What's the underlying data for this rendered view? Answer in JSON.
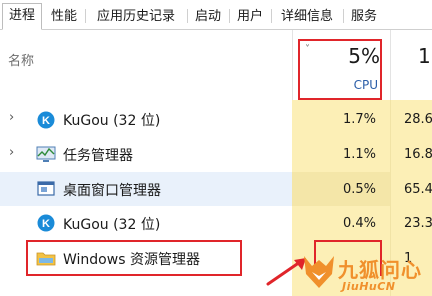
{
  "tabs": [
    {
      "label": "进程",
      "active": true
    },
    {
      "label": "性能",
      "active": false
    },
    {
      "label": "应用历史记录",
      "active": false
    },
    {
      "label": "启动",
      "active": false
    },
    {
      "label": "用户",
      "active": false
    },
    {
      "label": "详细信息",
      "active": false
    },
    {
      "label": "服务",
      "active": false
    }
  ],
  "header": {
    "name_label": "名称",
    "sort_arrow": "˅",
    "cpu_percent": "5%",
    "cpu_label": "CPU",
    "memory_percent_partial": "1"
  },
  "processes": [
    {
      "name": "KuGou (32 位)",
      "icon": "kugou-icon",
      "expandable": true,
      "cpu": "1.7%",
      "memory": "28.6"
    },
    {
      "name": "任务管理器",
      "icon": "task-manager-icon",
      "expandable": true,
      "cpu": "1.1%",
      "memory": "16.8"
    },
    {
      "name": "桌面窗口管理器",
      "icon": "window-manager-icon",
      "expandable": false,
      "cpu": "0.5%",
      "memory": "65.4"
    },
    {
      "name": "KuGou (32 位)",
      "icon": "kugou-icon",
      "expandable": false,
      "cpu": "0.4%",
      "memory": "23.3"
    },
    {
      "name": "Windows 资源管理器",
      "icon": "folder-icon",
      "expandable": false,
      "cpu": "",
      "memory": "1"
    }
  ],
  "watermark": {
    "text": "九狐问心",
    "sub": "JiuHuCN"
  },
  "colors": {
    "cpu_column": "#fcefb6",
    "cpu_label": "#2b5ea8",
    "annotation_red": "#e0252a",
    "watermark_orange": "#f0902c"
  }
}
